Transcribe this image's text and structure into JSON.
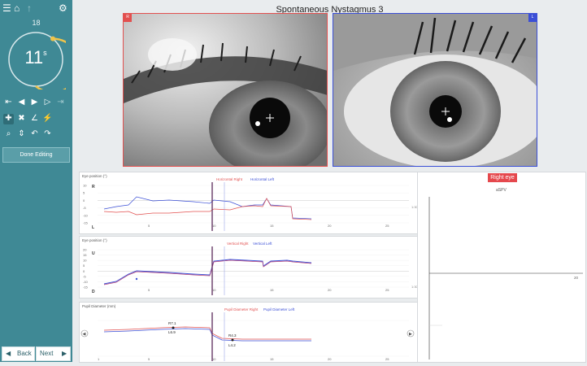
{
  "sidebar": {
    "timer_total": "18",
    "timer_value": "11",
    "timer_unit": "s",
    "timer_fraction": 0.61,
    "done_label": "Done Editing",
    "back_label": "Back",
    "next_label": "Next",
    "icons": [
      "menu-icon",
      "home-icon",
      "up-arrow-icon",
      "gear-icon"
    ]
  },
  "title": "Spontaneous Nystagmus 3",
  "eyes": {
    "right_badge": "R",
    "left_badge": "L",
    "right_color": "#e2504f",
    "left_color": "#3b4fd6"
  },
  "panels": [
    {
      "title": "Eye position (°)",
      "legend": [
        "Horizontal Right",
        "Horizontal Left"
      ],
      "y_ticks": [
        "10",
        "5",
        "0",
        "-5",
        "-10",
        "-15"
      ],
      "y_letters": [
        "R",
        "L"
      ],
      "x_ticks": [
        "5",
        "10",
        "15",
        "20",
        "25"
      ],
      "end_label": "1:30"
    },
    {
      "title": "Eye position (°)",
      "legend": [
        "Vertical Right",
        "Vertical Left"
      ],
      "y_ticks": [
        "20",
        "15",
        "10",
        "5",
        "0",
        "-5",
        "-10",
        "-15"
      ],
      "y_letters": [
        "U",
        "D"
      ],
      "x_ticks": [
        "5",
        "10",
        "15",
        "20",
        "25"
      ],
      "end_label": "1:30"
    },
    {
      "title": "Pupil Diameter (mm)",
      "legend": [
        "Pupil Diameter Right",
        "Pupil Diameter Left"
      ],
      "annotations": [
        "R7.1",
        "L6.9",
        "R4.3",
        "L4.2"
      ],
      "x_ticks": [
        "1",
        "5",
        "10",
        "15",
        "20",
        "25"
      ]
    }
  ],
  "spv_panel": {
    "button_label": "Right eye",
    "subtitle": "aSPV",
    "x_tick": "20"
  },
  "colors": {
    "accent": "#3f8995",
    "right": "#e2504f",
    "left": "#3b4fd6",
    "cursor": "#5a2a5a"
  }
}
